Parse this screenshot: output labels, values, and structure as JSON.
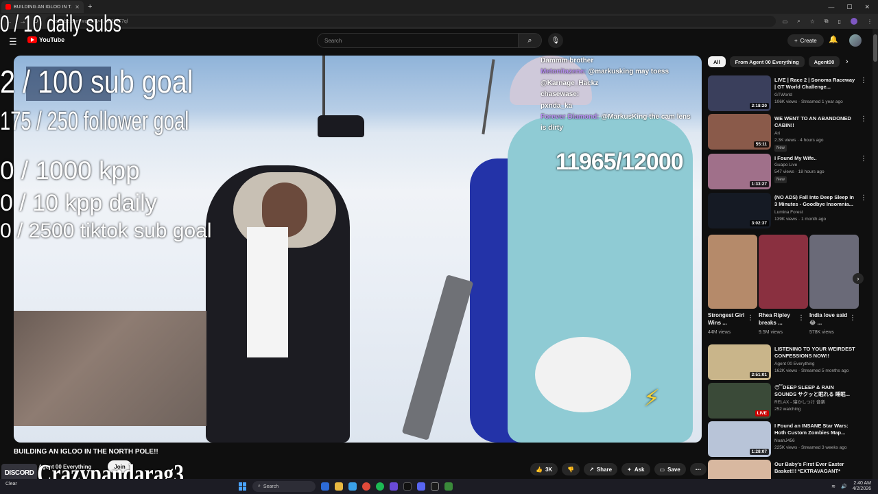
{
  "browser": {
    "tab_title": "BUILDING AN IGLOO IN T...",
    "url": "youtube.com/watch?v=...481kkT7ql"
  },
  "youtube": {
    "logo": "YouTube",
    "search_placeholder": "Search",
    "create_label": "Create"
  },
  "overlay": {
    "daily_subs": "0 / 10 daily subs",
    "sub_goal": "2 / 100 sub goal",
    "follower_goal": "175 / 250 follower goal",
    "kpp": "0 / 1000 kpp",
    "kpp_daily": "0 / 10 kpp daily",
    "tiktok_goal": "0 / 2500 tiktok sub goal",
    "username": "Crazypandarag3",
    "discord": "DISCORD"
  },
  "stream": {
    "counter": "11965/12000",
    "chat": [
      {
        "name": "",
        "text": "Dammm brother"
      },
      {
        "name": "Metonitazene:",
        "text": "@markusking may toess"
      },
      {
        "name": "",
        "text": "@Karnage_Hackz"
      },
      {
        "name": "",
        "text": "chasewase:"
      },
      {
        "name": "",
        "text": "pxnda_ka"
      },
      {
        "name": "Forever Diamond:",
        "text": "@MarkusKing the cam lens is dirty"
      }
    ]
  },
  "video": {
    "title": "BUILDING AN IGLOO IN THE NORTH POLE!!",
    "channel": "Agent 00 Everything",
    "join_label": "Join",
    "likes": "3K",
    "share_label": "Share",
    "ask_label": "Ask",
    "save_label": "Save"
  },
  "chips": [
    "All",
    "From Agent 00 Everything",
    "Agent00"
  ],
  "recommendations_top": [
    {
      "title": "LIVE | Race 2 | Sonoma Raceway | GT World Challenge...",
      "channel": "GTWorld",
      "meta": "106K views · Streamed 1 year ago",
      "duration": "2:18:20",
      "new": "",
      "thumb": "#3a3f5c"
    },
    {
      "title": "WE WENT TO AN ABANDONED CABIN!!",
      "channel": "Ari",
      "meta": "2.3K views · 4 hours ago",
      "duration": "55:11",
      "new": "New",
      "thumb": "#8a5a4a"
    },
    {
      "title": "I Found My Wife..",
      "channel": "Guapo Live",
      "meta": "547 views · 18 hours ago",
      "duration": "1:33:27",
      "new": "New",
      "thumb": "#a0708a"
    },
    {
      "title": "(NO ADS) Fall Into Deep Sleep in 3 Minutes - Goodbye Insomnia...",
      "channel": "Lumina Forest",
      "meta": "139K views · 1 month ago",
      "duration": "3:02:37",
      "new": "",
      "thumb": "#151a24"
    }
  ],
  "shorts": [
    {
      "title": "Strongest Girl Wins ...",
      "views": "44M views",
      "thumb": "#b58a6a"
    },
    {
      "title": "Rhea Ripley breaks ...",
      "views": "9.5M views",
      "thumb": "#8a3040"
    },
    {
      "title": "India love said 😂 ...",
      "views": "578K views",
      "thumb": "#6a6a78"
    }
  ],
  "recommendations_bottom": [
    {
      "title": "LISTENING TO YOUR WEIRDEST CONFESSIONS NOW!!",
      "channel": "Agent 00 Everything",
      "meta": "162K views · Streamed 5 months ago",
      "duration": "2:51:01",
      "live": "",
      "thumb": "#c9b58a"
    },
    {
      "title": "😴DEEP SLEEP & RAIN SOUNDS サクッと眠れる 睡眠...",
      "channel": "RELAX - 寝かしつけ 音楽",
      "meta": "252 watching",
      "duration": "",
      "live": "LIVE",
      "thumb": "#3a4a38"
    },
    {
      "title": "I Found an INSANE Star Wars: Hoth Custom Zombies Map...",
      "channel": "NoahJ456",
      "meta": "225K views · Streamed 3 weeks ago",
      "duration": "1:28:07",
      "live": "",
      "thumb": "#b8c4d8"
    },
    {
      "title": "Our Baby's First Ever Easter Basket!!! *EXTRAVAGANT*",
      "channel": "",
      "meta": "",
      "duration": "",
      "live": "",
      "thumb": "#d8b8a0"
    }
  ],
  "taskbar": {
    "search_label": "Search",
    "time": "2:40 AM",
    "date": "4/2/2026",
    "weather": "Clear"
  }
}
